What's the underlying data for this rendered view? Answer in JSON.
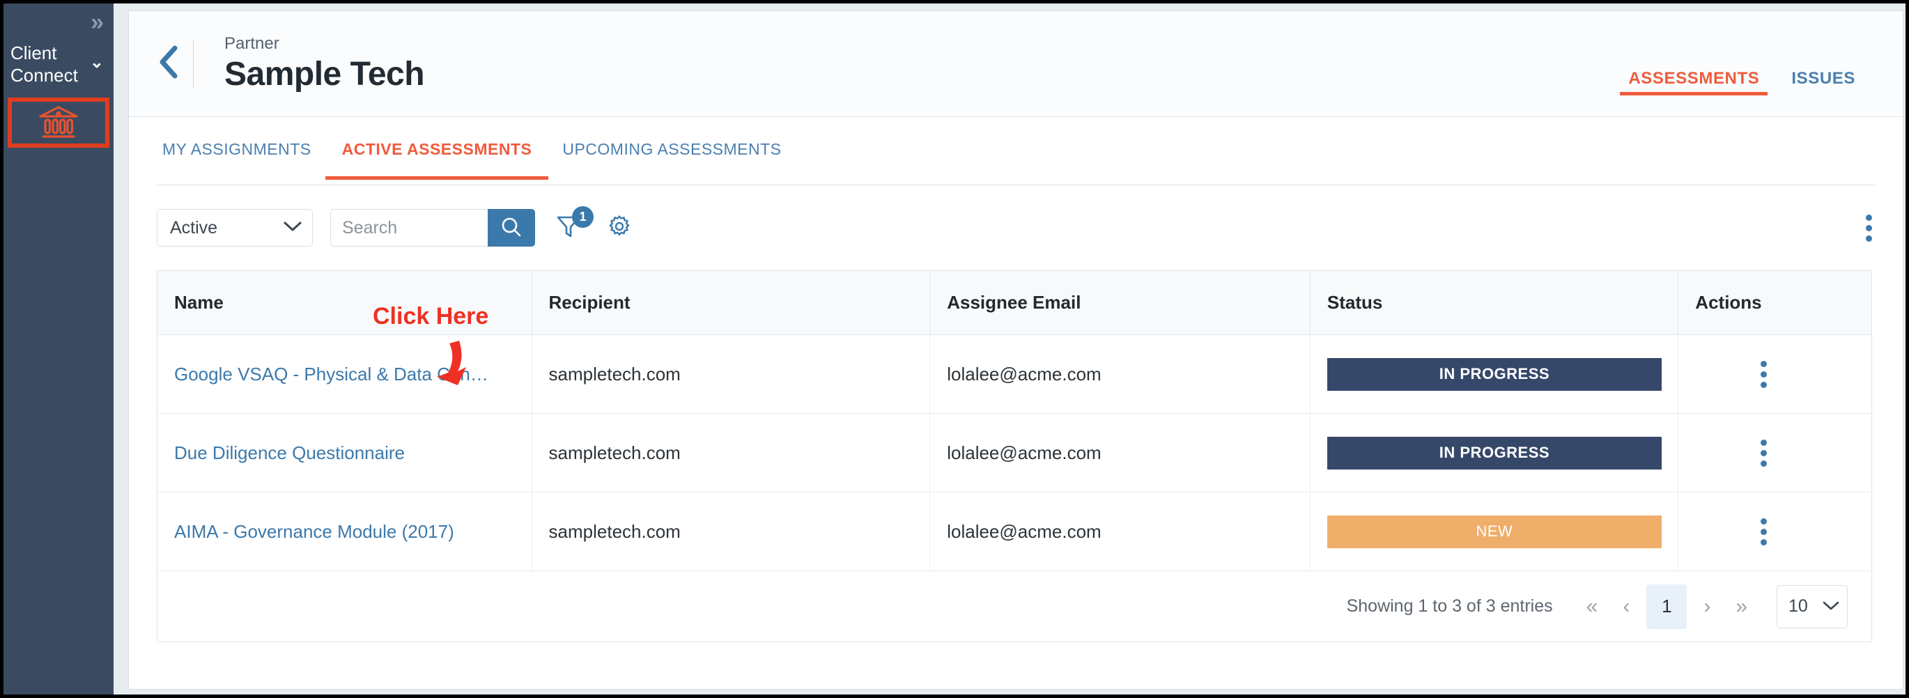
{
  "sidebar": {
    "expand_icon": "chevrons-right-icon",
    "brand": "Client Connect",
    "brand_caret_icon": "chevron-down-icon",
    "nav_item": {
      "icon": "bank-institution-icon",
      "highlight_color": "#e03c1f"
    }
  },
  "header": {
    "back_icon": "chevron-left-icon",
    "eyebrow": "Partner",
    "title": "Sample Tech",
    "tabs": [
      {
        "label": "ASSESSMENTS",
        "active": true
      },
      {
        "label": "ISSUES",
        "active": false
      }
    ]
  },
  "subtabs": [
    {
      "label": "MY ASSIGNMENTS",
      "active": false
    },
    {
      "label": "ACTIVE ASSESSMENTS",
      "active": true
    },
    {
      "label": "UPCOMING ASSESSMENTS",
      "active": false
    }
  ],
  "toolbar": {
    "status_filter": {
      "value": "Active",
      "caret_icon": "chevron-down-icon"
    },
    "search": {
      "value": "",
      "placeholder": "Search",
      "button_icon": "search-icon"
    },
    "filter": {
      "icon": "funnel-filter-icon",
      "badge": "1"
    },
    "settings": {
      "icon": "gear-icon"
    },
    "overflow": {
      "icon": "kebab-vertical-icon"
    }
  },
  "table": {
    "columns": [
      "Name",
      "Recipient",
      "Assignee Email",
      "Status",
      "Actions"
    ],
    "rows": [
      {
        "name": "Google VSAQ - Physical & Data Cen…",
        "recipient": "sampletech.com",
        "assignee_email": "lolalee@acme.com",
        "status": "IN PROGRESS",
        "status_color": "#36486a",
        "actions_icon": "kebab-vertical-icon"
      },
      {
        "name": "Due Diligence Questionnaire",
        "recipient": "sampletech.com",
        "assignee_email": "lolalee@acme.com",
        "status": "IN PROGRESS",
        "status_color": "#36486a",
        "actions_icon": "kebab-vertical-icon"
      },
      {
        "name": "AIMA - Governance Module (2017)",
        "recipient": "sampletech.com",
        "assignee_email": "lolalee@acme.com",
        "status": "NEW",
        "status_color": "#efae6a",
        "actions_icon": "kebab-vertical-icon"
      }
    ]
  },
  "pagination": {
    "info": "Showing 1 to 3 of 3 entries",
    "first_label": "«",
    "prev_label": "‹",
    "current_page": "1",
    "next_label": "›",
    "last_label": "»",
    "page_size": "10",
    "page_size_caret_icon": "chevron-down-icon"
  },
  "annotation": {
    "label": "Click Here",
    "color": "#ee3124",
    "arrow_icon": "arrow-down-left-icon"
  },
  "colors": {
    "accent_orange": "#ef5b3c",
    "link_blue": "#3c79ab",
    "sidebar_navy": "#3a4b61",
    "status_in_progress": "#36486a",
    "status_new": "#efae6a"
  }
}
